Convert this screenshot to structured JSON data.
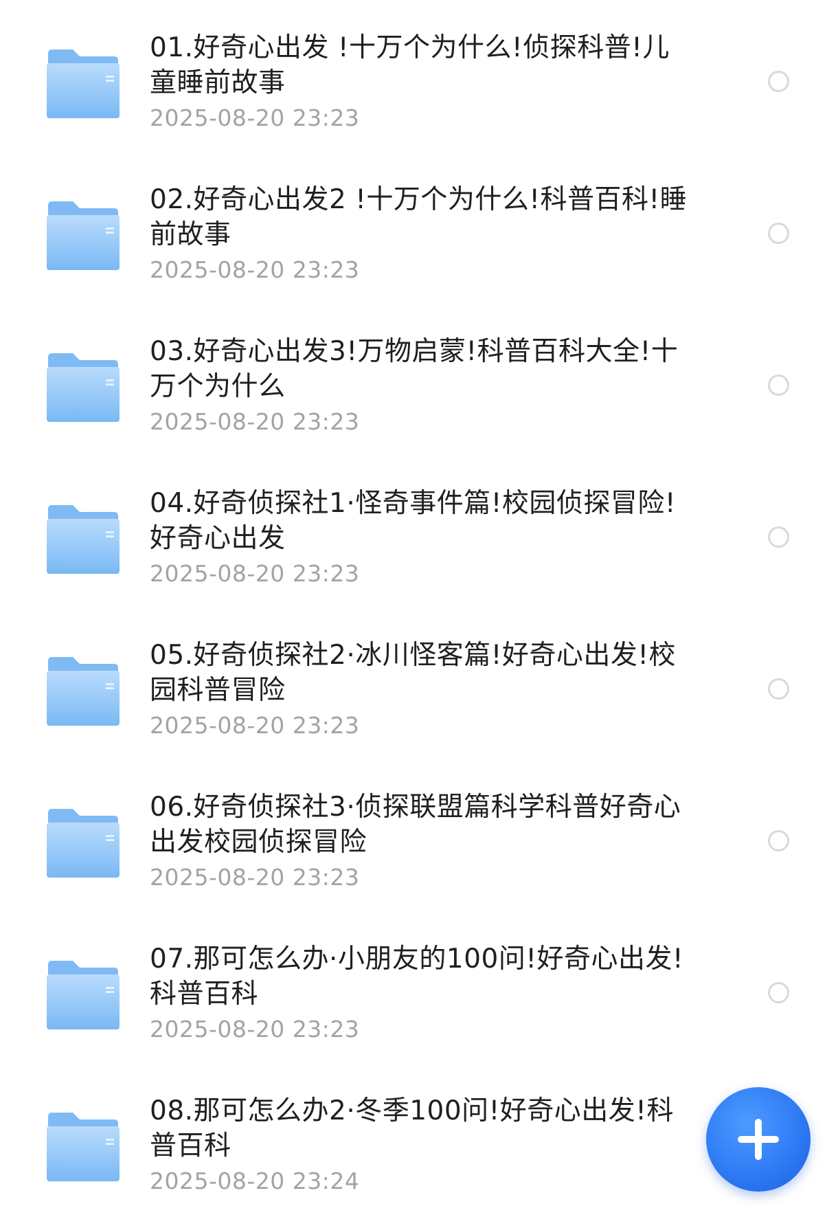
{
  "files": [
    {
      "name": "01.好奇心出发 !十万个为什么!侦探科普!儿童睡前故事",
      "time": "2025-08-20 23:23"
    },
    {
      "name": "02.好奇心出发2 !十万个为什么!科普百科!睡前故事",
      "time": "2025-08-20 23:23"
    },
    {
      "name": "03.好奇心出发3!万物启蒙!科普百科大全!十万个为什么",
      "time": "2025-08-20 23:23"
    },
    {
      "name": "04.好奇侦探社1·怪奇事件篇!校园侦探冒险!好奇心出发",
      "time": "2025-08-20 23:23"
    },
    {
      "name": "05.好奇侦探社2·冰川怪客篇!好奇心出发!校园科普冒险",
      "time": "2025-08-20 23:23"
    },
    {
      "name": "06.好奇侦探社3·侦探联盟篇科学科普好奇心出发校园侦探冒险",
      "time": "2025-08-20 23:23"
    },
    {
      "name": "07.那可怎么办·小朋友的100问!好奇心出发!科普百科",
      "time": "2025-08-20 23:23"
    },
    {
      "name": "08.那可怎么办2·冬季100问!好奇心出发!科普百科",
      "time": "2025-08-20 23:24"
    }
  ],
  "icons": {
    "row_icon": "folder-icon",
    "select": "radio-circle-icon",
    "fab": "plus-icon"
  },
  "colors": {
    "folder_light": "#a9d3fb",
    "folder_dark": "#6fb1f3",
    "fab": "#2f7bf5",
    "title_text": "#1f1f1f",
    "time_text": "#a3a3a3",
    "radio_border": "#d9d9d9"
  }
}
